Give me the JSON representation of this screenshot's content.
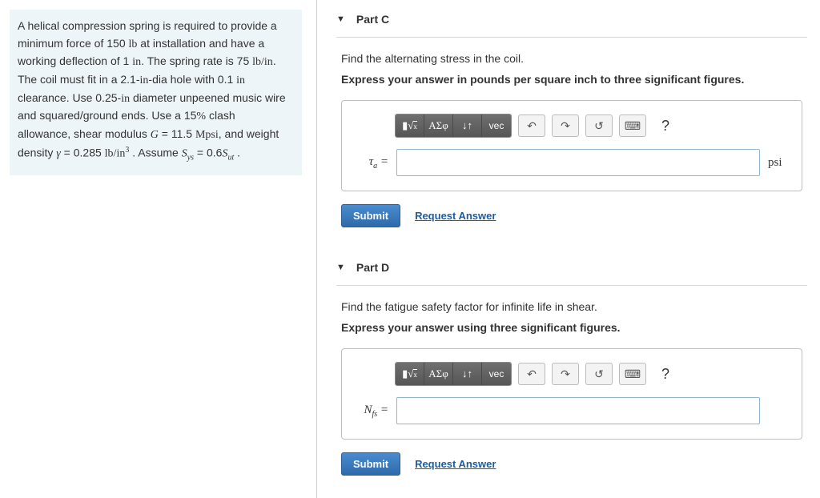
{
  "problem": {
    "text_parts": [
      "A helical compression spring is required to provide a minimum force of 150 ",
      "lb",
      " at installation and have a working deflection of 1 ",
      "in",
      ". The spring rate is 75 ",
      "lb/in",
      ". The coil must fit in a 2.1-",
      "in",
      "-dia hole with 0.1 ",
      "in",
      " clearance. Use 0.25-",
      "in",
      " diameter unpeened music wire and squared/ground ends. Use a 15",
      "%",
      " clash allowance, shear modulus ",
      "G",
      " = 11.5 ",
      "Mpsi",
      ", and weight density ",
      "γ",
      " = 0.285 ",
      "lb/in",
      "3",
      " . Assume ",
      "S",
      "ys",
      " = 0.6",
      "S",
      "ut",
      " ."
    ]
  },
  "toolbar": {
    "template_icon": "▮",
    "sqrt_icon": "√",
    "greek": "ΑΣφ",
    "arrows": "↓↑",
    "vec": "vec",
    "undo": "↶",
    "redo": "↷",
    "reset": "↺",
    "keyboard": "⌨",
    "help": "?"
  },
  "actions": {
    "submit": "Submit",
    "request": "Request Answer"
  },
  "partC": {
    "title": "Part C",
    "prompt": "Find the alternating stress in the coil.",
    "instruction": "Express your answer in pounds per square inch to three significant figures.",
    "var_label": "τₐ =",
    "unit": "psi",
    "value": ""
  },
  "partD": {
    "title": "Part D",
    "prompt": "Find the fatigue safety factor for infinite life in shear.",
    "instruction": "Express your answer using three significant figures.",
    "var_label": "N_fs =",
    "unit": "",
    "value": ""
  }
}
